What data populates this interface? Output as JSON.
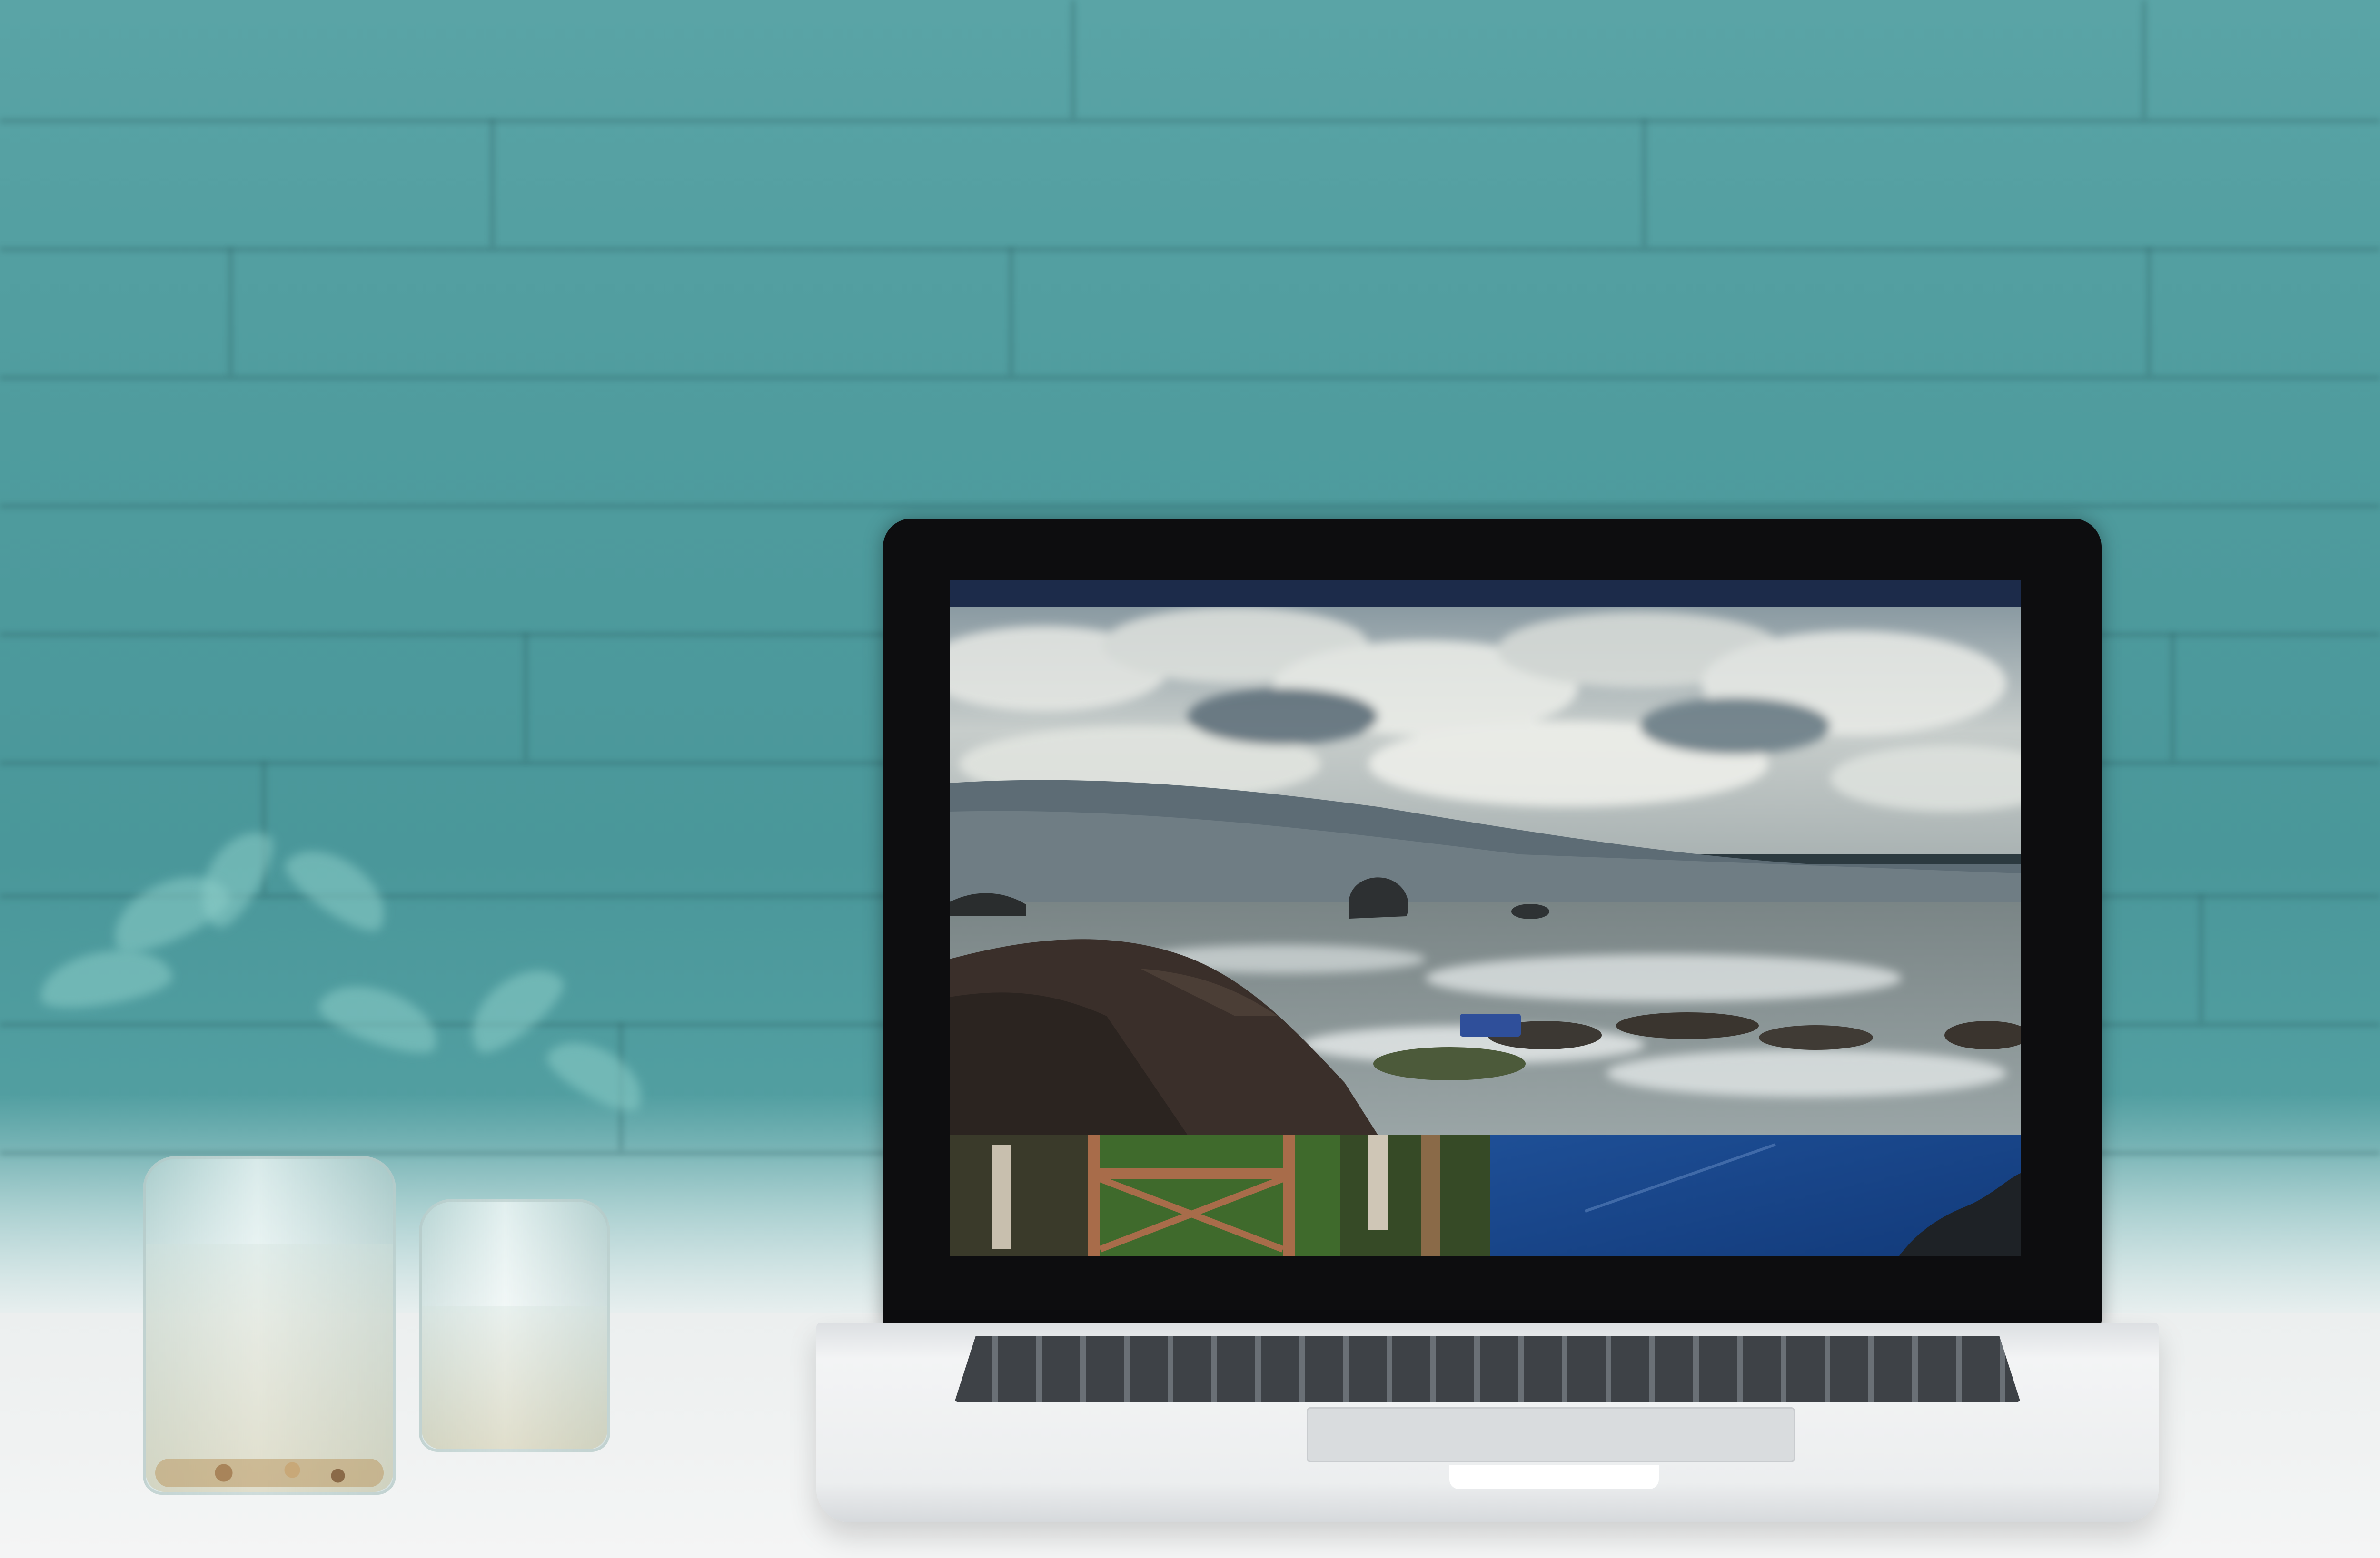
{
  "scene": {
    "wall_color": "#4e9a9c",
    "table_color": "#f1f2f2",
    "laptop_bezel_color": "#0d0d0f"
  },
  "website": {
    "nav": {
      "brand": "",
      "links": [
        "",
        "",
        ""
      ]
    },
    "hero": {
      "title": "",
      "button_label": "",
      "image": "coastal-cliffs-photo"
    },
    "tiles": [
      {
        "image": "rope-bridge-photo"
      },
      {
        "image": "blue-sky-cliff-photo"
      }
    ],
    "accent_color": "#1c2b4a",
    "button_color": "#2f4f9a"
  }
}
